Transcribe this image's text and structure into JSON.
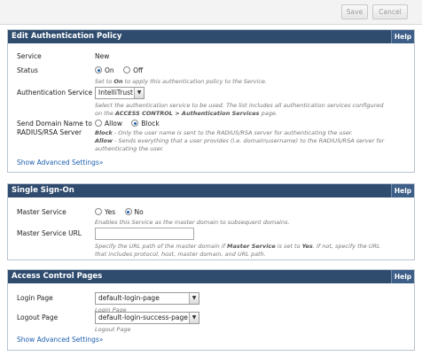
{
  "toolbar": {
    "save_label": "Save",
    "cancel_label": "Cancel"
  },
  "auth_panel": {
    "title": "Edit Authentication Policy",
    "help": "Help",
    "service": {
      "label": "Service",
      "value": "New"
    },
    "status": {
      "label": "Status",
      "on": "On",
      "off": "Off",
      "selected": "On",
      "desc_pre": "Set to ",
      "desc_bold": "On",
      "desc_post": " to apply this authentication policy to the Service."
    },
    "auth_service": {
      "label": "Authentication Service",
      "selected": "IntelliTrust",
      "desc_1": "Select the authentication service to be used. The list includes all authentication services configured",
      "desc_2_pre": "on the ",
      "desc_2_bold": "ACCESS CONTROL > Authentication Services",
      "desc_2_post": " page."
    },
    "send_domain": {
      "label_1": "Send Domain Name to",
      "label_2": "RADIUS/RSA Server",
      "allow": "Allow",
      "block": "Block",
      "selected": "Block",
      "desc_block_bold": "Block",
      "desc_block": " - Only the user name is sent to the RADIUS/RSA server for authenticating the user.",
      "desc_allow_bold": "Allow",
      "desc_allow_1": " - Sends everything that a user provides (i.e. domain\\username) to the RADIUS/RSA server for",
      "desc_allow_2": "authenticating the user."
    },
    "advanced": "Show Advanced Settings"
  },
  "sso_panel": {
    "title": "Single Sign-On",
    "help": "Help",
    "master_service": {
      "label": "Master Service",
      "yes": "Yes",
      "no": "No",
      "selected": "No",
      "desc": "Enables this Service as the master domain to subsequent domains."
    },
    "master_url": {
      "label": "Master Service URL",
      "value": "",
      "desc_1_pre": "Specify the URL path of the master domain if ",
      "desc_1_bold1": "Master Service",
      "desc_1_mid": " is set to ",
      "desc_1_bold2": "Yes",
      "desc_1_post": ". If not, specify the URL",
      "desc_2": "that includes protocol, host, master domain, and URL path."
    }
  },
  "acp_panel": {
    "title": "Access Control Pages",
    "help": "Help",
    "login": {
      "label": "Login Page",
      "selected": "default-login-page",
      "hint": "Login Page"
    },
    "logout": {
      "label": "Logout Page",
      "selected": "default-login-success-page",
      "hint": "Logout Page"
    },
    "advanced": "Show Advanced Settings"
  }
}
